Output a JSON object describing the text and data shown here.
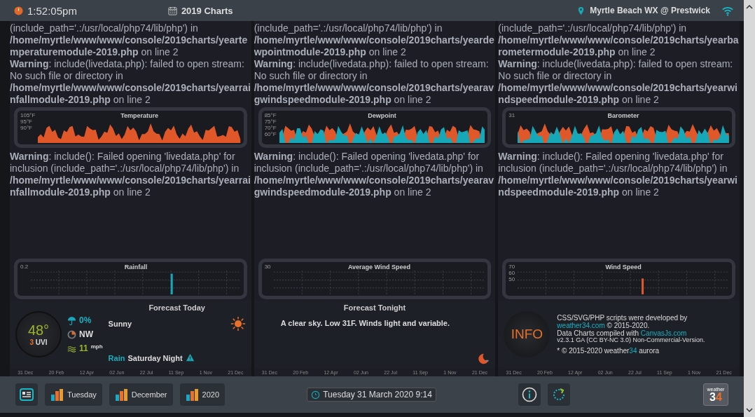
{
  "top_bar": {
    "time": "1:52:05pm",
    "page_title": "2019 Charts",
    "station": "Myrtle Beach WX @ Prestwick"
  },
  "columns": [
    {
      "errors_top": [
        "(include_path='.:/usr/local/php74/lib/php') in **/home/myrtle/www/www/console/2019charts/yeartemperaturemodule-2019.php** on line 2",
        "**Warning**: include(livedata.php): failed to open stream: No such file or directory in **/home/myrtle/www/www/console/2019charts/yearrainfallmodule-2019.php** on line 2"
      ],
      "upper_chart": {
        "title": "Temperature",
        "ticks": [
          "105°F",
          "95°F",
          "90°F"
        ]
      },
      "error": "**Warning**: include(): Failed opening 'livedata.php' for inclusion (include_path='.:/usr/local/php74/lib/php') in **/home/myrtle/www/www/console/2019charts/yearrainfallmodule-2019.php** on line 2",
      "lower_chart": {
        "title": "Rainfall",
        "ticks": [
          "0.2"
        ]
      },
      "panel": {
        "kind": "today",
        "title": "Forecast Today",
        "temperature": "48°",
        "uvi_value": "3",
        "uvi_label": "UVI",
        "rain_chance": "0%",
        "wind_direction": "NW",
        "wind_speed": "11",
        "wind_unit": "mph",
        "condition": "Sunny",
        "rain_label": "Rain",
        "rain_when": "Saturday Night"
      },
      "axis_labels": [
        "31 Dec",
        "20 Feb",
        "12 Apr",
        "02 Jun",
        "22 Jul",
        "11 Sep",
        "1 Nov",
        "21 Dec"
      ]
    },
    {
      "errors_top": [
        "(include_path='.:/usr/local/php74/lib/php') in **/home/myrtle/www/www/console/2019charts/yeardewpointmodule-2019.php** on line 2",
        "**Warning**: include(livedata.php): failed to open stream: No such file or directory in **/home/myrtle/www/www/console/2019charts/yearavgwindspeedmodule-2019.php** on line 2"
      ],
      "upper_chart": {
        "title": "Dewpoint",
        "ticks": [
          "85°F",
          "75°F",
          "70°F",
          "60°F"
        ]
      },
      "error": "**Warning**: include(): Failed opening 'livedata.php' for inclusion (include_path='.:/usr/local/php74/lib/php') in **/home/myrtle/www/www/console/2019charts/yearavgwindspeedmodule-2019.php** on line 2",
      "lower_chart": {
        "title": "Average Wind Speed",
        "ticks": [
          "30"
        ]
      },
      "panel": {
        "kind": "tonight",
        "title": "Forecast Tonight",
        "text": "A clear sky. Low 31F. Winds light and variable."
      },
      "axis_labels": [
        "31 Dec",
        "20 Feb",
        "12 Apr",
        "02 Jun",
        "22 Jul",
        "11 Sep",
        "1 Nov",
        "21 Dec"
      ]
    },
    {
      "errors_top": [
        "(include_path='.:/usr/local/php74/lib/php') in **/home/myrtle/www/www/console/2019charts/yearbarometermodule-2019.php** on line 2",
        "**Warning**: include(livedata.php): failed to open stream: No such file or directory in **/home/myrtle/www/www/console/2019charts/yearwindspeedmodule-2019.php** on line 2"
      ],
      "upper_chart": {
        "title": "Barometer",
        "ticks": [
          "31"
        ]
      },
      "error": "**Warning**: include(): Failed opening 'livedata.php' for inclusion (include_path='.:/usr/local/php74/lib/php') in **/home/myrtle/www/www/console/2019charts/yearwindspeedmodule-2019.php** on line 2",
      "lower_chart": {
        "title": "Wind Speed",
        "ticks": [
          "70",
          "60",
          "50"
        ]
      },
      "panel": {
        "kind": "info",
        "badge": "INFO",
        "credit_before": "CSS/SVG/PHP scripts were developed by",
        "credit_link": "weather34.com",
        "credit_after": "© 2015-2020.",
        "charts_before": "Data Charts compiled with",
        "charts_link": "CanvasJs.com",
        "version": "v2.3.1 GA (CC BY-NC 3.0) Non-Commercial-Version.",
        "copyright_before": "* © 2015-2020 weather",
        "copyright_brand": "34",
        "copyright_after": "aurora"
      },
      "axis_labels": [
        "31 Dec",
        "20 Feb",
        "12 Apr",
        "02 Jun",
        "22 Jul",
        "11 Sep",
        "1 Nov",
        "21 Dec"
      ]
    }
  ],
  "bottom_bar": {
    "chart_buttons": [
      "Tuesday",
      "December",
      "2020"
    ],
    "datetime": "Tuesday 31 March 2020 9:14",
    "logo_small": "weather",
    "logo_three": "3",
    "logo_four": "4"
  }
}
